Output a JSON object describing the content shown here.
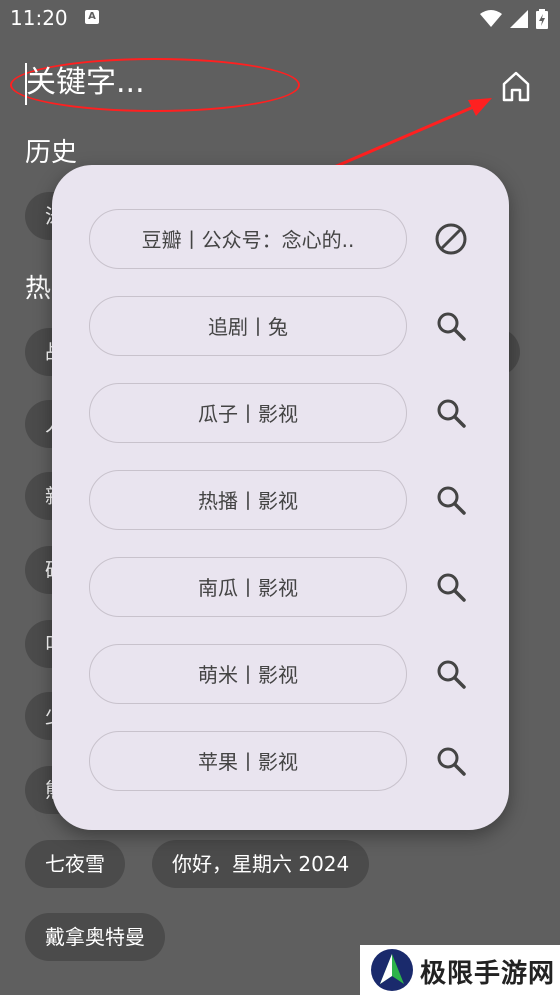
{
  "status": {
    "time": "11:20",
    "notif_badge": "A"
  },
  "search": {
    "placeholder": "关键字..."
  },
  "history": {
    "title": "历史",
    "chips": [
      "泳"
    ]
  },
  "hot": {
    "title": "热",
    "chips": [
      "战",
      "人",
      "新",
      "破",
      "叫",
      "少",
      "熊",
      "七夜雪",
      "你好，星期六 2024",
      "戴拿奥特曼"
    ]
  },
  "sources": [
    {
      "label": "豆瓣丨公众号：念心的..",
      "icon": "block-icon"
    },
    {
      "label": "追剧丨兔",
      "icon": "search-icon"
    },
    {
      "label": "瓜子丨影视",
      "icon": "search-icon"
    },
    {
      "label": "热播丨影视",
      "icon": "search-icon"
    },
    {
      "label": "南瓜丨影视",
      "icon": "search-icon"
    },
    {
      "label": "萌米丨影视",
      "icon": "search-icon"
    },
    {
      "label": "苹果丨影视",
      "icon": "search-icon"
    }
  ],
  "watermark": {
    "text": "极限手游网"
  },
  "colors": {
    "backdrop": "#5f5f5f",
    "chip": "#4b4b4b",
    "popup": "#e9e4ef",
    "annotation": "#ff2020"
  }
}
